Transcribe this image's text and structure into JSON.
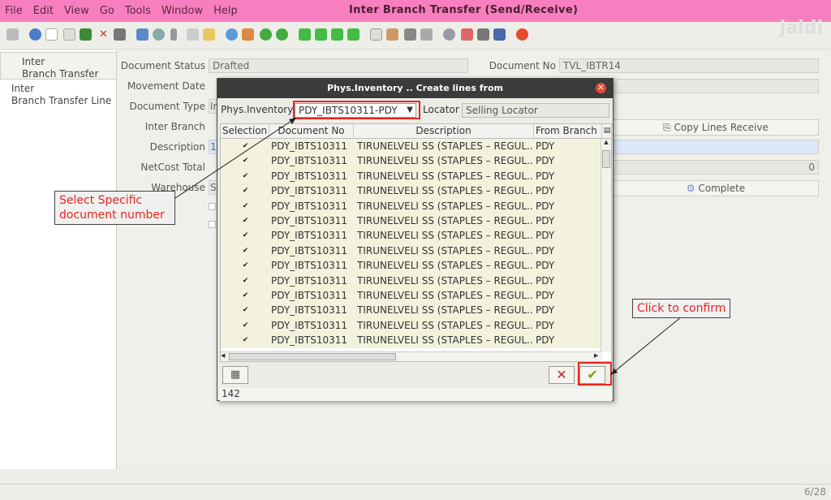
{
  "menu": [
    "File",
    "Edit",
    "View",
    "Go",
    "Tools",
    "Window",
    "Help"
  ],
  "app_title": "Inter Branch Transfer (Send/Receive)",
  "nav": [
    "Inter\nBranch Transfer",
    "Inter\nBranch Transfer Line"
  ],
  "form": {
    "doc_status_label": "Document Status",
    "doc_status": "Drafted",
    "doc_no_label": "Document No",
    "doc_no": "TVL_IBTR14",
    "movement_date_label": "Movement Date",
    "doc_type_label": "Document Type",
    "doc_type": "In",
    "inter_branch_label": "Inter Branch",
    "description_label": "Description",
    "description": "1",
    "netcost_label": "NetCost Total",
    "netcost": "0",
    "warehouse_label": "Warehouse",
    "warehouse": "Se",
    "copy_lines_receive": "Copy Lines Receive",
    "complete": "Complete"
  },
  "dialog": {
    "title": "Phys.Inventory .. Create lines from",
    "phys_label": "Phys.Inventory",
    "phys_value": "PDY_IBTS10311-PDY",
    "locator_label": "Locator",
    "locator_value": "Selling Locator",
    "columns": [
      "Selection",
      "Document No",
      "Description",
      "From Branch"
    ],
    "rows": [
      {
        "doc": "PDY_IBTS10311",
        "desc": "TIRUNELVELI SS (STAPLES – REGUL...",
        "branch": "PDY"
      },
      {
        "doc": "PDY_IBTS10311",
        "desc": "TIRUNELVELI SS (STAPLES – REGUL...",
        "branch": "PDY"
      },
      {
        "doc": "PDY_IBTS10311",
        "desc": "TIRUNELVELI SS (STAPLES – REGUL...",
        "branch": "PDY"
      },
      {
        "doc": "PDY_IBTS10311",
        "desc": "TIRUNELVELI SS (STAPLES – REGUL...",
        "branch": "PDY"
      },
      {
        "doc": "PDY_IBTS10311",
        "desc": "TIRUNELVELI SS (STAPLES – REGUL...",
        "branch": "PDY"
      },
      {
        "doc": "PDY_IBTS10311",
        "desc": "TIRUNELVELI SS (STAPLES – REGUL...",
        "branch": "PDY"
      },
      {
        "doc": "PDY_IBTS10311",
        "desc": "TIRUNELVELI SS (STAPLES – REGUL...",
        "branch": "PDY"
      },
      {
        "doc": "PDY_IBTS10311",
        "desc": "TIRUNELVELI SS (STAPLES – REGUL...",
        "branch": "PDY"
      },
      {
        "doc": "PDY_IBTS10311",
        "desc": "TIRUNELVELI SS (STAPLES – REGUL...",
        "branch": "PDY"
      },
      {
        "doc": "PDY_IBTS10311",
        "desc": "TIRUNELVELI SS (STAPLES – REGUL...",
        "branch": "PDY"
      },
      {
        "doc": "PDY_IBTS10311",
        "desc": "TIRUNELVELI SS (STAPLES – REGUL...",
        "branch": "PDY"
      },
      {
        "doc": "PDY_IBTS10311",
        "desc": "TIRUNELVELI SS (STAPLES – REGUL...",
        "branch": "PDY"
      },
      {
        "doc": "PDY_IBTS10311",
        "desc": "TIRUNELVELI SS (STAPLES – REGUL...",
        "branch": "PDY"
      },
      {
        "doc": "PDY_IBTS10311",
        "desc": "TIRUNELVELI SS (STAPLES – REGUL...",
        "branch": "PDY"
      }
    ],
    "count": "142"
  },
  "callouts": {
    "select_doc": "Select Specific document number",
    "confirm": "Click to confirm"
  },
  "status": {
    "page": "6/28"
  },
  "watermark": "jaldi"
}
